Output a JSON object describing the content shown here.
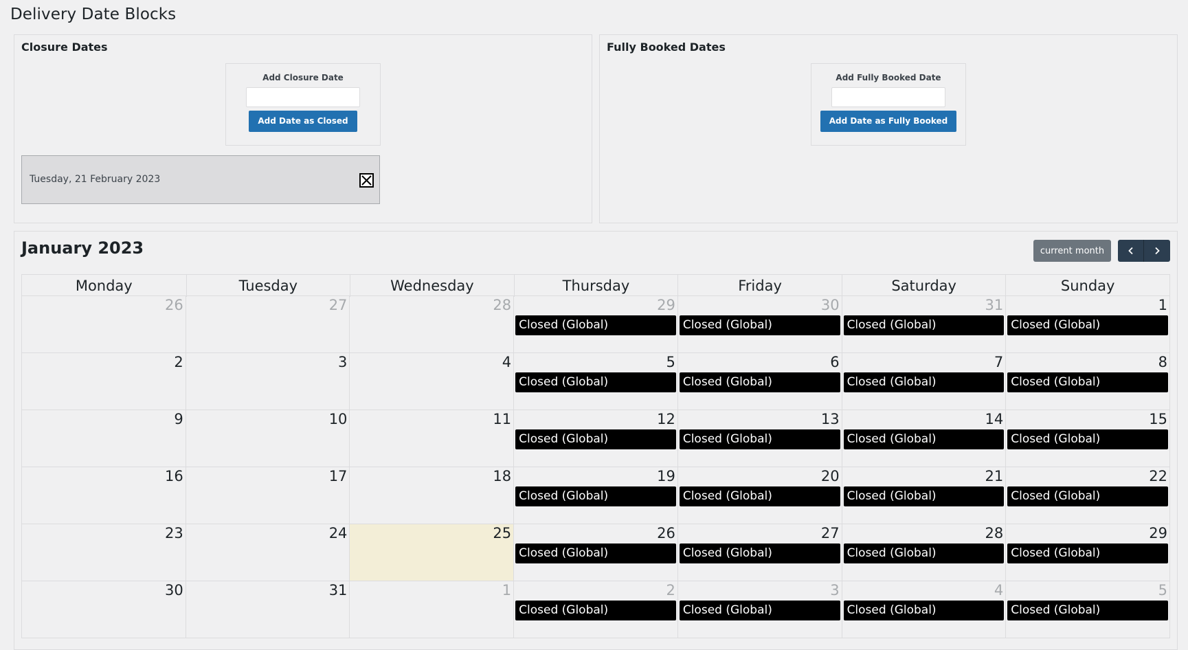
{
  "page": {
    "title": "Delivery Date Blocks"
  },
  "closure": {
    "title": "Closure Dates",
    "add_label": "Add Closure Date",
    "input_value": "",
    "button_label": "Add Date as Closed",
    "items": [
      {
        "label": "Tuesday, 21 February 2023"
      }
    ]
  },
  "booked": {
    "title": "Fully Booked Dates",
    "add_label": "Add Fully Booked Date",
    "input_value": "",
    "button_label": "Add Date as Fully Booked"
  },
  "calendar": {
    "title": "January 2023",
    "current_month_label": "current month",
    "prev_icon": "chevron-left-icon",
    "next_icon": "chevron-right-icon",
    "weekdays": [
      "Monday",
      "Tuesday",
      "Wednesday",
      "Thursday",
      "Friday",
      "Saturday",
      "Sunday"
    ],
    "event_color": "#000000",
    "today_color": "#f3eed7",
    "days": [
      {
        "day": "26",
        "other": true,
        "event": ""
      },
      {
        "day": "27",
        "other": true,
        "event": ""
      },
      {
        "day": "28",
        "other": true,
        "event": ""
      },
      {
        "day": "29",
        "other": true,
        "event": "Closed (Global)"
      },
      {
        "day": "30",
        "other": true,
        "event": "Closed (Global)"
      },
      {
        "day": "31",
        "other": true,
        "event": "Closed (Global)"
      },
      {
        "day": "1",
        "other": false,
        "event": "Closed (Global)"
      },
      {
        "day": "2",
        "other": false,
        "event": ""
      },
      {
        "day": "3",
        "other": false,
        "event": ""
      },
      {
        "day": "4",
        "other": false,
        "event": ""
      },
      {
        "day": "5",
        "other": false,
        "event": "Closed (Global)"
      },
      {
        "day": "6",
        "other": false,
        "event": "Closed (Global)"
      },
      {
        "day": "7",
        "other": false,
        "event": "Closed (Global)"
      },
      {
        "day": "8",
        "other": false,
        "event": "Closed (Global)"
      },
      {
        "day": "9",
        "other": false,
        "event": ""
      },
      {
        "day": "10",
        "other": false,
        "event": ""
      },
      {
        "day": "11",
        "other": false,
        "event": ""
      },
      {
        "day": "12",
        "other": false,
        "event": "Closed (Global)"
      },
      {
        "day": "13",
        "other": false,
        "event": "Closed (Global)"
      },
      {
        "day": "14",
        "other": false,
        "event": "Closed (Global)"
      },
      {
        "day": "15",
        "other": false,
        "event": "Closed (Global)"
      },
      {
        "day": "16",
        "other": false,
        "event": ""
      },
      {
        "day": "17",
        "other": false,
        "event": ""
      },
      {
        "day": "18",
        "other": false,
        "event": ""
      },
      {
        "day": "19",
        "other": false,
        "event": "Closed (Global)"
      },
      {
        "day": "20",
        "other": false,
        "event": "Closed (Global)"
      },
      {
        "day": "21",
        "other": false,
        "event": "Closed (Global)"
      },
      {
        "day": "22",
        "other": false,
        "event": "Closed (Global)"
      },
      {
        "day": "23",
        "other": false,
        "event": ""
      },
      {
        "day": "24",
        "other": false,
        "event": ""
      },
      {
        "day": "25",
        "other": false,
        "event": "",
        "today": true
      },
      {
        "day": "26",
        "other": false,
        "event": "Closed (Global)"
      },
      {
        "day": "27",
        "other": false,
        "event": "Closed (Global)"
      },
      {
        "day": "28",
        "other": false,
        "event": "Closed (Global)"
      },
      {
        "day": "29",
        "other": false,
        "event": "Closed (Global)"
      },
      {
        "day": "30",
        "other": false,
        "event": ""
      },
      {
        "day": "31",
        "other": false,
        "event": ""
      },
      {
        "day": "1",
        "other": true,
        "event": ""
      },
      {
        "day": "2",
        "other": true,
        "event": "Closed (Global)"
      },
      {
        "day": "3",
        "other": true,
        "event": "Closed (Global)"
      },
      {
        "day": "4",
        "other": true,
        "event": "Closed (Global)"
      },
      {
        "day": "5",
        "other": true,
        "event": "Closed (Global)"
      }
    ]
  }
}
